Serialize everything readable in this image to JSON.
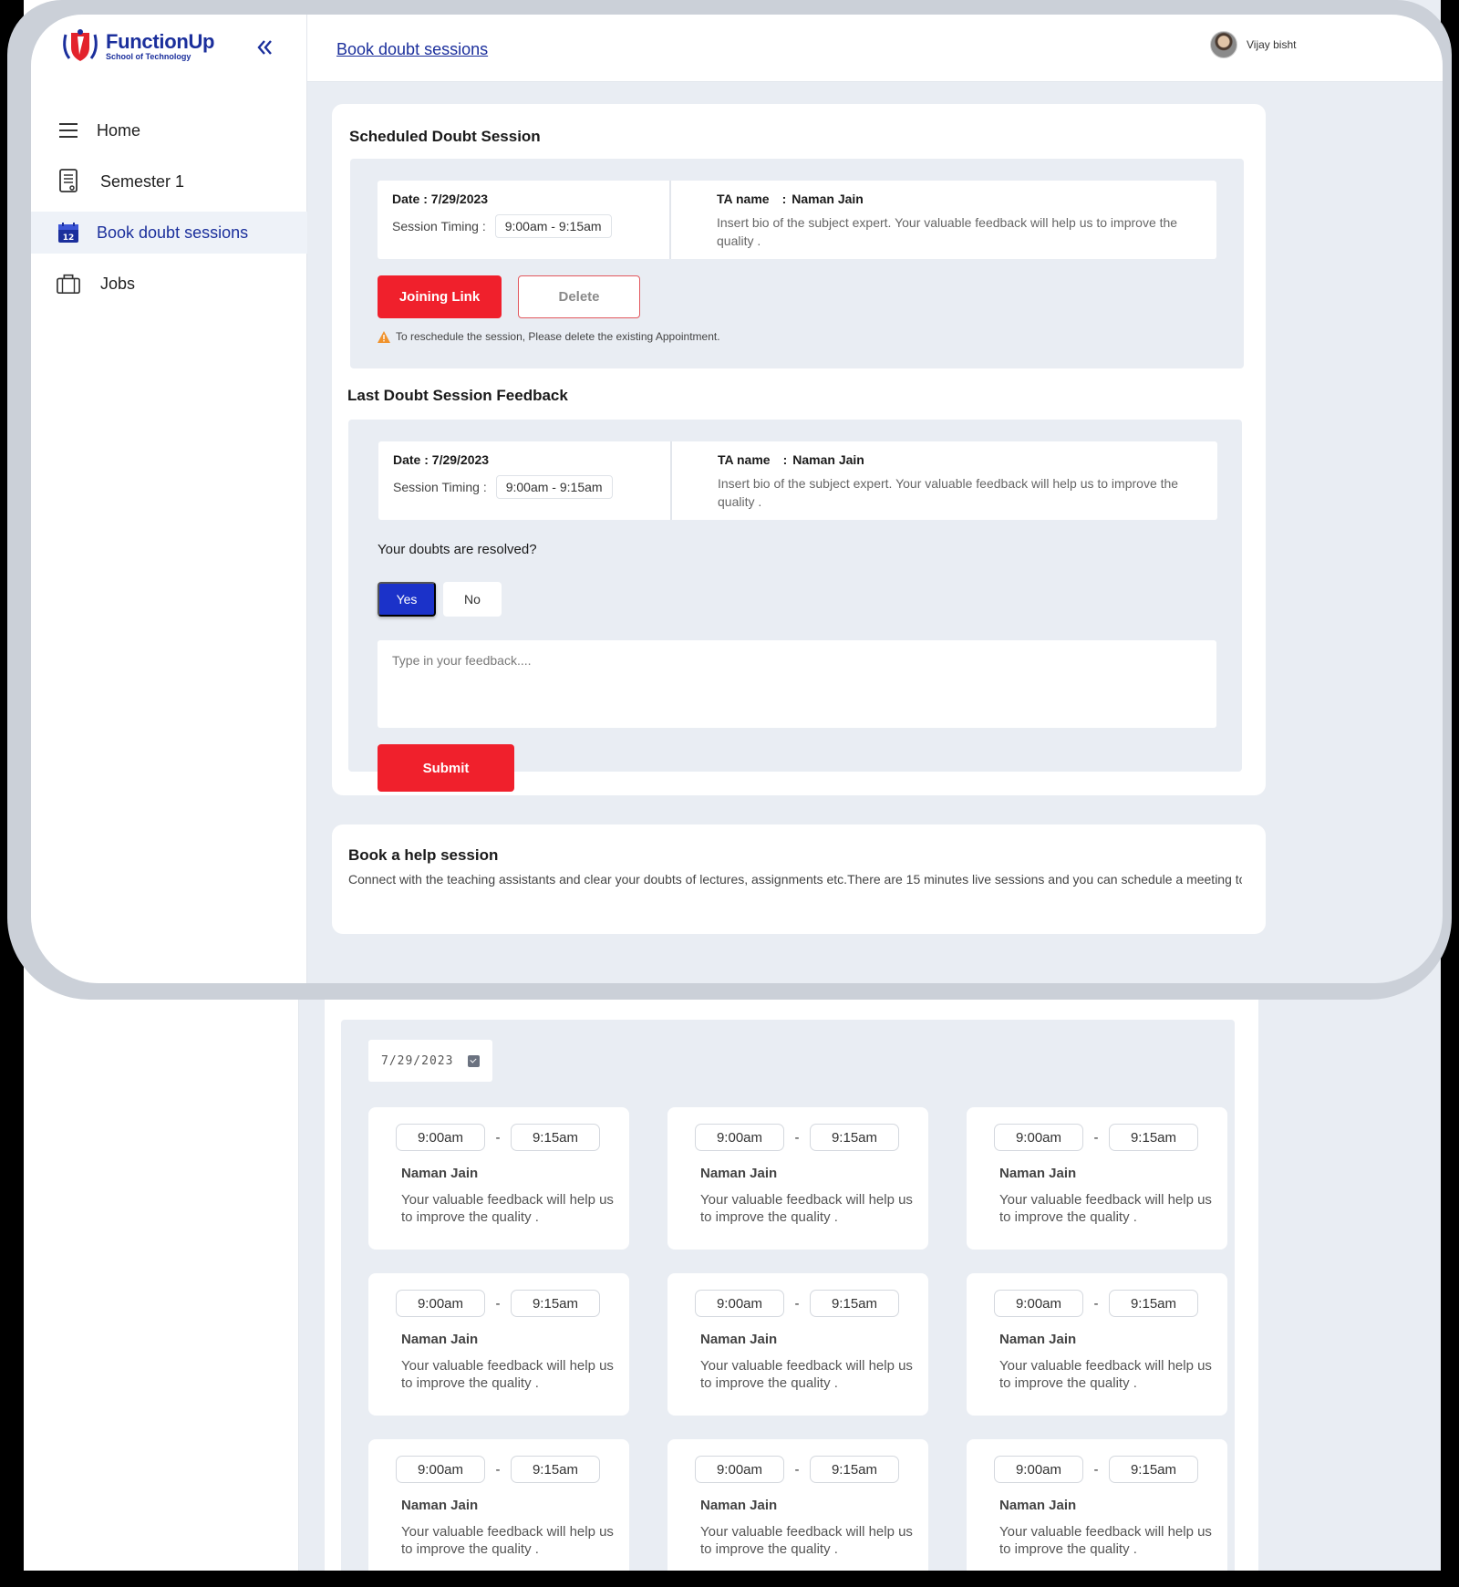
{
  "brand": {
    "name": "FunctionUp",
    "tagline": "School of Technology"
  },
  "sidebar": {
    "items": [
      {
        "label": "Home",
        "icon": "menu-icon"
      },
      {
        "label": "Semester 1",
        "icon": "document-icon"
      },
      {
        "label": "Book doubt sessions",
        "icon": "calendar-icon",
        "active": true
      },
      {
        "label": "Jobs",
        "icon": "briefcase-icon"
      }
    ]
  },
  "header": {
    "breadcrumb": "Book doubt sessions",
    "user_name": "Vijay bisht"
  },
  "scheduled": {
    "title": "Scheduled Doubt Session",
    "date": "Date : 7/29/2023",
    "timing_label": "Session Timing :",
    "timing": "9:00am - 9:15am",
    "ta_label": "TA name",
    "ta_sep": ":",
    "ta_name": "Naman Jain",
    "bio": "Insert bio of the subject expert. Your valuable feedback will help us to improve the quality .",
    "join_label": "Joining Link",
    "delete_label": "Delete",
    "warning": "To reschedule the session, Please delete the existing Appointment."
  },
  "feedback": {
    "title": "Last Doubt Session Feedback",
    "date": "Date : 7/29/2023",
    "timing_label": "Session Timing :",
    "timing": "9:00am - 9:15am",
    "ta_label": "TA name",
    "ta_sep": ":",
    "ta_name": "Naman Jain",
    "bio": "Insert bio of the subject expert. Your valuable feedback will help us to improve the quality .",
    "question": "Your doubts are resolved?",
    "yes_label": "Yes",
    "no_label": "No",
    "placeholder": "Type in your feedback....",
    "submit_label": "Submit"
  },
  "help": {
    "title": "Book a help session",
    "description": "Connect with the teaching assistants and clear your doubts of lectures, assignments etc.There are 15 minutes live sessions and you can schedule a meeting today.",
    "date_value": "7/29/2023",
    "slots": [
      {
        "start": "9:00am",
        "sep": "-",
        "end": "9:15am",
        "name": "Naman Jain",
        "desc": "Your valuable feedback will help us to improve the quality ."
      },
      {
        "start": "9:00am",
        "sep": "-",
        "end": "9:15am",
        "name": "Naman Jain",
        "desc": "Your valuable feedback will help us to improve the quality ."
      },
      {
        "start": "9:00am",
        "sep": "-",
        "end": "9:15am",
        "name": "Naman Jain",
        "desc": "Your valuable feedback will help us to improve the quality ."
      },
      {
        "start": "9:00am",
        "sep": "-",
        "end": "9:15am",
        "name": "Naman Jain",
        "desc": "Your valuable feedback will help us to improve the quality ."
      },
      {
        "start": "9:00am",
        "sep": "-",
        "end": "9:15am",
        "name": "Naman Jain",
        "desc": "Your valuable feedback will help us to improve the quality ."
      },
      {
        "start": "9:00am",
        "sep": "-",
        "end": "9:15am",
        "name": "Naman Jain",
        "desc": "Your valuable feedback will help us to improve the quality ."
      },
      {
        "start": "9:00am",
        "sep": "-",
        "end": "9:15am",
        "name": "Naman Jain",
        "desc": "Your valuable feedback will help us to improve the quality ."
      },
      {
        "start": "9:00am",
        "sep": "-",
        "end": "9:15am",
        "name": "Naman Jain",
        "desc": "Your valuable feedback will help us to improve the quality ."
      },
      {
        "start": "9:00am",
        "sep": "-",
        "end": "9:15am",
        "name": "Naman Jain",
        "desc": "Your valuable feedback will help us to improve the quality ."
      }
    ]
  },
  "colors": {
    "accent_red": "#f0202c",
    "brand_blue": "#1b2f9c",
    "yes_blue": "#1b32c9",
    "page_bg": "#e9edf3"
  }
}
